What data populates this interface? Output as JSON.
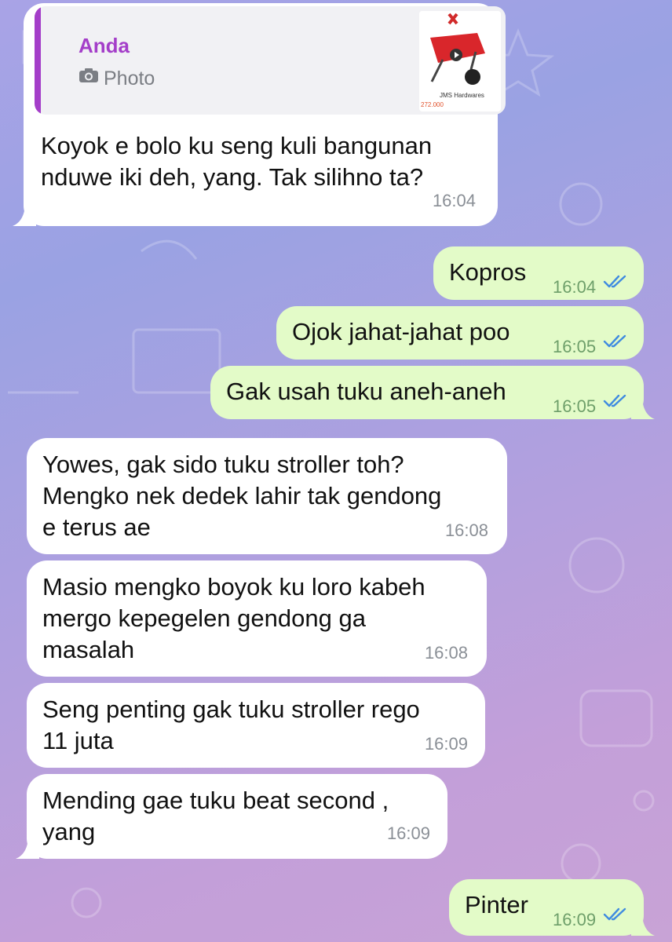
{
  "colors": {
    "incoming_bubble": "#ffffff",
    "outgoing_bubble": "#e3fbc8",
    "reply_accent": "#a43ec9",
    "read_ticks": "#3f8be0"
  },
  "messages": [
    {
      "direction": "incoming",
      "reply": {
        "name": "Anda",
        "type_icon": "camera-icon",
        "type": "Photo",
        "thumb_brand": "JMS Hardwares",
        "thumb_price": "272.000"
      },
      "text": "Koyok e bolo ku seng kuli bangunan\nnduwe iki deh, yang. Tak silihno ta?",
      "time": "16:04"
    },
    {
      "direction": "outgoing",
      "text": "Kopros",
      "time": "16:04",
      "status_icon": "double-check-icon"
    },
    {
      "direction": "outgoing",
      "text": "Ojok jahat-jahat poo",
      "time": "16:05",
      "status_icon": "double-check-icon"
    },
    {
      "direction": "outgoing",
      "text": "Gak usah tuku aneh-aneh",
      "time": "16:05",
      "status_icon": "double-check-icon"
    },
    {
      "direction": "incoming",
      "text": "Yowes, gak sido tuku stroller toh?\nMengko nek dedek lahir tak gendong\ne terus ae",
      "time": "16:08"
    },
    {
      "direction": "incoming",
      "text": "Masio mengko boyok ku loro kabeh\nmergo kepegelen gendong ga\nmasalah",
      "time": "16:08"
    },
    {
      "direction": "incoming",
      "text": "Seng penting gak tuku stroller rego\n11 juta",
      "time": "16:09"
    },
    {
      "direction": "incoming",
      "text": "Mending gae tuku beat second ,\nyang",
      "time": "16:09"
    },
    {
      "direction": "outgoing",
      "text": "Pinter",
      "time": "16:09",
      "status_icon": "double-check-icon"
    }
  ]
}
